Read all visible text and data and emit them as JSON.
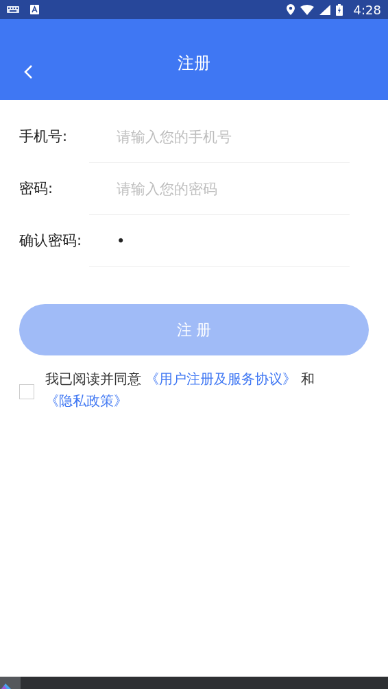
{
  "status_bar": {
    "time": "4:28"
  },
  "header": {
    "title": "注册"
  },
  "fields": [
    {
      "label": "手机号:",
      "placeholder": "请输入您的手机号"
    },
    {
      "label": "密码:",
      "placeholder": "请输入您的密码"
    },
    {
      "label": "确认密码:",
      "value": "•"
    }
  ],
  "submit_button": {
    "label": "注 册",
    "disabled": true
  },
  "agreement": {
    "checked": false,
    "parts": [
      {
        "kind": "text",
        "text": "我已阅读并同意"
      },
      {
        "kind": "link",
        "text": "《用户注册及服务协议》"
      },
      {
        "kind": "text",
        "text": "和"
      },
      {
        "kind": "link",
        "text": "《隐私政策》"
      }
    ]
  }
}
